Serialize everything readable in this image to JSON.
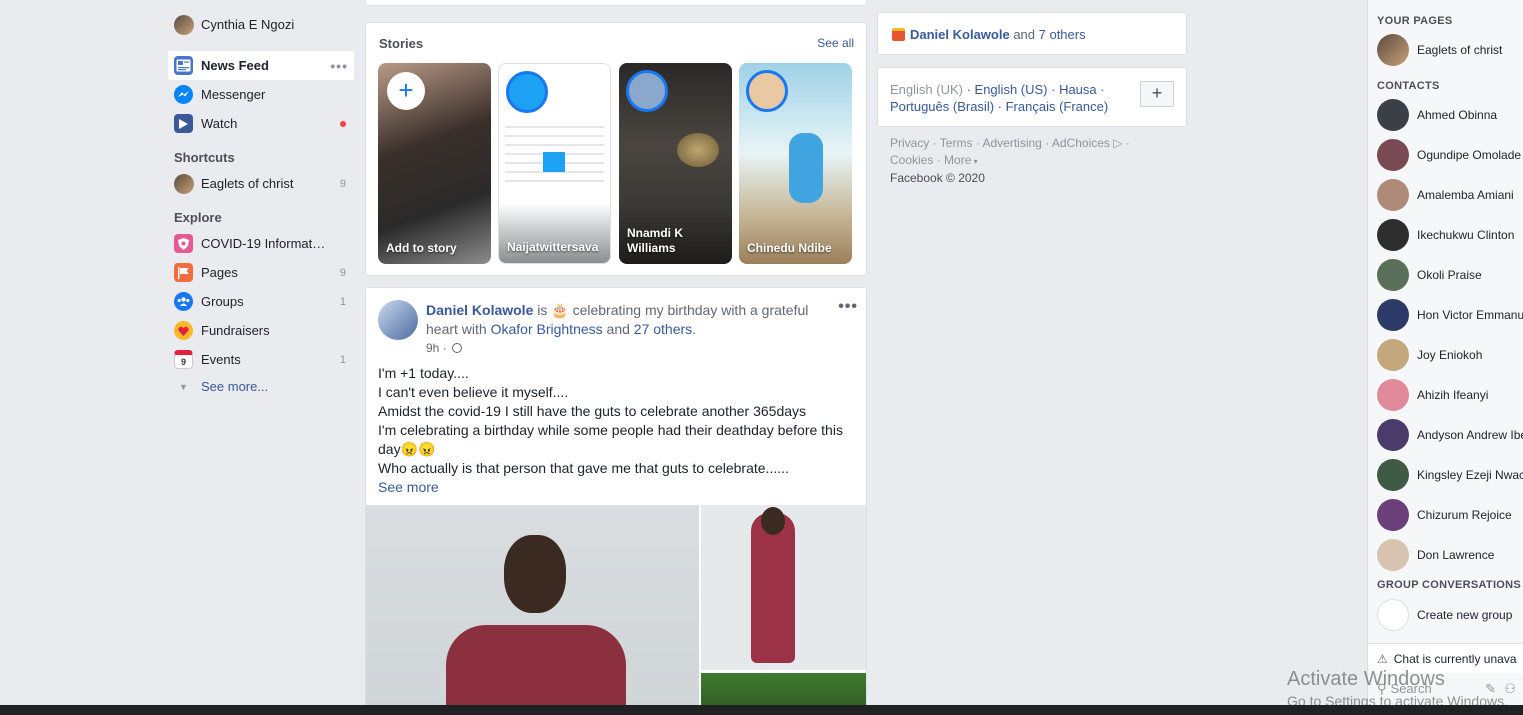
{
  "left_nav": {
    "profile_name": "Cynthia E Ngozi",
    "items": [
      {
        "label": "News Feed"
      },
      {
        "label": "Messenger"
      },
      {
        "label": "Watch"
      }
    ],
    "shortcuts_heading": "Shortcuts",
    "shortcuts": [
      {
        "label": "Eaglets of christ",
        "count": "9"
      }
    ],
    "explore_heading": "Explore",
    "explore": [
      {
        "label": "COVID-19 Informat…",
        "count": ""
      },
      {
        "label": "Pages",
        "count": "9"
      },
      {
        "label": "Groups",
        "count": "1"
      },
      {
        "label": "Fundraisers",
        "count": ""
      },
      {
        "label": "Events",
        "count": "1"
      }
    ],
    "see_more": "See more..."
  },
  "stories": {
    "title": "Stories",
    "see_all": "See all",
    "items": [
      {
        "label": "Add to story"
      },
      {
        "label": "Naijatwittersava"
      },
      {
        "label": "Nnamdi K Williams"
      },
      {
        "label": "Chinedu Ndibe"
      }
    ]
  },
  "post": {
    "author": "Daniel Kolawole",
    "action_pre": " is ",
    "action_emoji": "🎂",
    "action": " celebrating my birthday with a grateful heart with ",
    "tagged": "Okafor Brightness",
    "and": " and ",
    "others": "27 others",
    "time": "9h ·",
    "lines": [
      "I'm +1 today....",
      "I can't even believe it myself....",
      "Amidst the covid-19 I still have the guts to celebrate another 365days",
      "I'm celebrating a birthday while some people had their deathday before this",
      "day😠😠",
      "Who actually is that person that gave me that guts to celebrate......"
    ],
    "see_more": "See more"
  },
  "birthday": {
    "name": "Daniel Kolawole",
    "and": " and ",
    "others": "7 others"
  },
  "languages": {
    "current": "English (UK)",
    "options": [
      "English (US)",
      "Hausa",
      "Português (Brasil)",
      "Français (France)"
    ]
  },
  "footer": {
    "links": [
      "Privacy",
      "Terms",
      "Advertising",
      "AdChoices",
      "Cookies",
      "More"
    ],
    "copyright": "Facebook © 2020"
  },
  "chat": {
    "your_pages_heading": "YOUR PAGES",
    "pages": [
      {
        "name": "Eaglets of christ"
      }
    ],
    "contacts_heading": "CONTACTS",
    "contacts": [
      {
        "name": "Ahmed Obinna",
        "color": "#3b3f47"
      },
      {
        "name": "Ogundipe Omolade",
        "color": "#7a4a52"
      },
      {
        "name": "Amalemba Amiani",
        "color": "#b08a78"
      },
      {
        "name": "Ikechukwu Clinton",
        "color": "#2d2d2d"
      },
      {
        "name": "Okoli Praise",
        "color": "#5a6f5a"
      },
      {
        "name": "Hon Victor Emmanu",
        "color": "#2b3a67"
      },
      {
        "name": "Joy Eniokoh",
        "color": "#c4a77d"
      },
      {
        "name": "Ahizih Ifeanyi",
        "color": "#e08a9a"
      },
      {
        "name": "Andyson Andrew Ibe",
        "color": "#4b3b6b"
      },
      {
        "name": "Kingsley Ezeji Nwac",
        "color": "#3f5a45"
      },
      {
        "name": "Chizurum Rejoice",
        "color": "#6a3f7a"
      },
      {
        "name": "Don Lawrence",
        "color": "#d8c2b0"
      }
    ],
    "group_heading": "GROUP CONVERSATIONS",
    "create_group": "Create new group",
    "warning": "Chat is currently unava",
    "search": "Search"
  },
  "watermark": {
    "title": "Activate Windows",
    "subtitle": "Go to Settings to activate Windows."
  }
}
